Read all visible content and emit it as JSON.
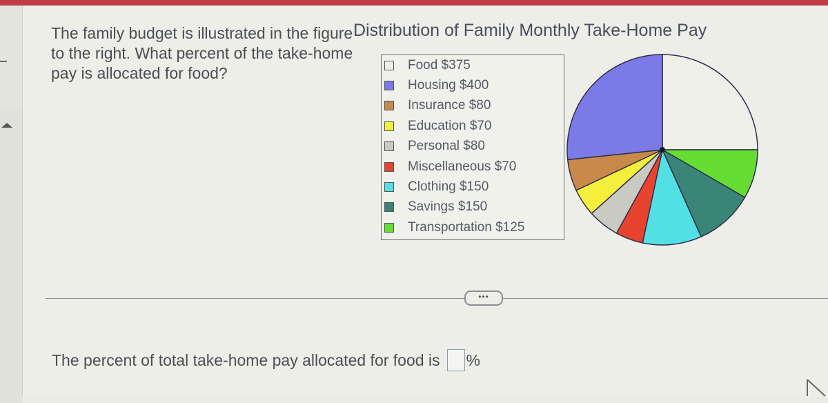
{
  "question": {
    "text": "The family budget is illustrated in the figure to the right. What percent of the take-home pay is allocated for food?"
  },
  "answer": {
    "prompt": "The percent of total take-home pay allocated for food is",
    "value": "",
    "unit": "%"
  },
  "more_button": {
    "label": "•••"
  },
  "chart_data": {
    "type": "pie",
    "title": "Distribution of Family Monthly Take-Home Pay",
    "legend_position": "left",
    "categories": [
      "Food",
      "Housing",
      "Insurance",
      "Education",
      "Personal",
      "Miscellaneous",
      "Clothing",
      "Savings",
      "Transportation"
    ],
    "values": [
      375,
      400,
      80,
      70,
      80,
      70,
      150,
      150,
      125
    ],
    "legend_labels": [
      "Food $375",
      "Housing $400",
      "Insurance $80",
      "Education $70",
      "Personal $80",
      "Miscellaneous $70",
      "Clothing $150",
      "Savings $150",
      "Transportation $125"
    ],
    "colors": [
      "#efefe9",
      "#7b7ae6",
      "#c8894a",
      "#f4ef3c",
      "#c9cbc3",
      "#e8432e",
      "#52e0e4",
      "#3a8478",
      "#66dd33"
    ],
    "start": "12 o'clock",
    "direction": "counterclockwise from Housing; Food occupies top-right quadrant"
  }
}
